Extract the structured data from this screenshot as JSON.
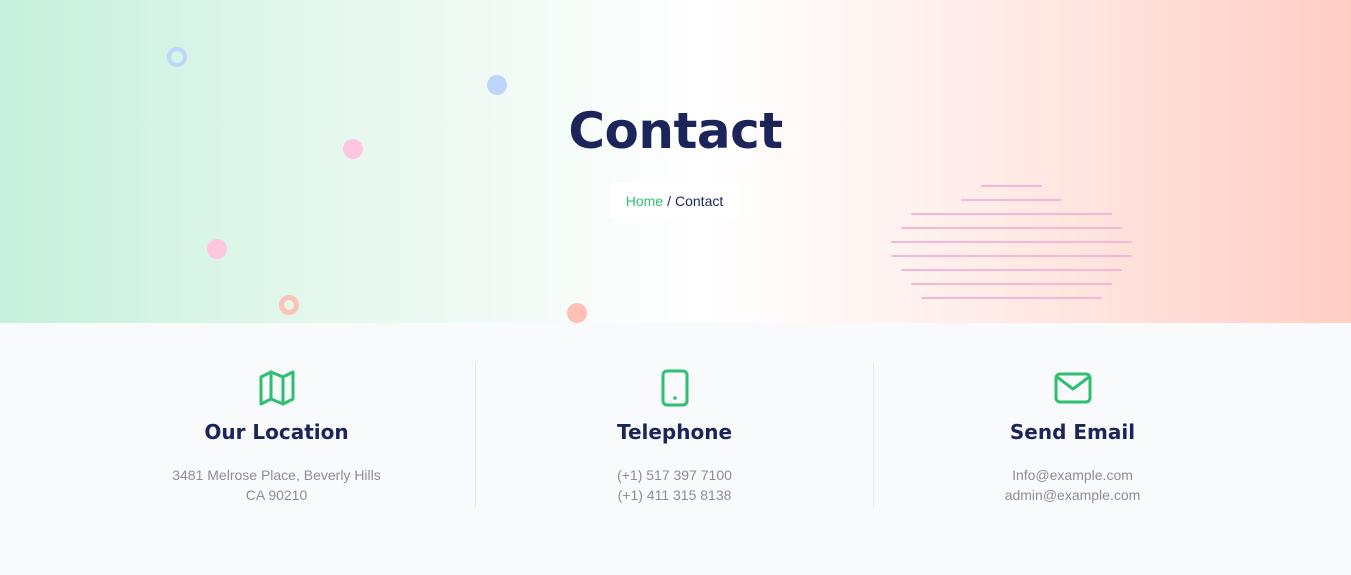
{
  "hero": {
    "title": "Contact",
    "breadcrumb": {
      "home_label": "Home",
      "separator": "/",
      "current_label": "Contact"
    }
  },
  "colors": {
    "accent_green": "#2fbf71",
    "heading_navy": "#1b2559",
    "muted_text": "#8a8e9c",
    "decor_blue": "#bcd6fb",
    "decor_pink": "#ffc6e2",
    "decor_salmon": "#ffc1b6",
    "decor_stripes": "#f6b7d6"
  },
  "contact_cards": [
    {
      "icon": "map-icon",
      "title": "Our Location",
      "lines": [
        "3481 Melrose Place, Beverly Hills",
        "CA 90210"
      ]
    },
    {
      "icon": "phone-icon",
      "title": "Telephone",
      "lines": [
        "(+1) 517 397 7100",
        "(+1) 411 315 8138"
      ]
    },
    {
      "icon": "mail-icon",
      "title": "Send Email",
      "lines": [
        "Info@example.com",
        "admin@example.com"
      ]
    }
  ]
}
